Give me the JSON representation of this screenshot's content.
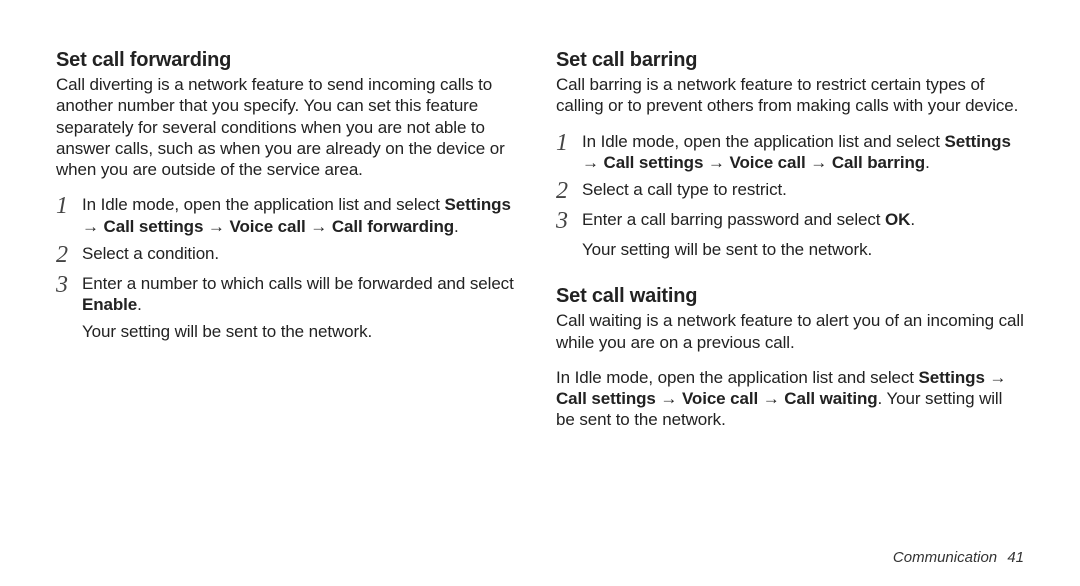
{
  "left": {
    "forwarding": {
      "heading": "Set call forwarding",
      "intro": "Call diverting is a network feature to send incoming calls to another number that you specify. You can set this feature separately for several conditions when you are not able to answer calls, such as when you are already on the device or when you are outside of the service area.",
      "steps": [
        {
          "num": "1",
          "plain_before": "In Idle mode, open the application list and select ",
          "bold1": "Settings",
          "arrow1": " → ",
          "bold2": "Call settings",
          "arrow2": " → ",
          "bold3": "Voice call",
          "arrow3": " → ",
          "bold4": "Call forwarding",
          "tail": "."
        },
        {
          "num": "2",
          "plain": "Select a condition."
        },
        {
          "num": "3",
          "plain_before": "Enter a number to which calls will be forwarded and select ",
          "bold1": "Enable",
          "tail": ".",
          "after": "Your setting will be sent to the network."
        }
      ]
    }
  },
  "right": {
    "barring": {
      "heading": "Set call barring",
      "intro": "Call barring is a network feature to restrict certain types of calling or to prevent others from making calls with your device.",
      "steps": [
        {
          "num": "1",
          "plain_before": "In Idle mode, open the application list and select ",
          "bold1": "Settings",
          "arrow1": " → ",
          "bold2": "Call settings",
          "arrow2": " → ",
          "bold3": "Voice call",
          "arrow3": " → ",
          "bold4": "Call barring",
          "tail": "."
        },
        {
          "num": "2",
          "plain": "Select a call type to restrict."
        },
        {
          "num": "3",
          "plain_before": "Enter a call barring password and select ",
          "bold1": "OK",
          "tail": ".",
          "after": "Your setting will be sent to the network."
        }
      ]
    },
    "waiting": {
      "heading": "Set call waiting",
      "intro": "Call waiting is a network feature to alert you of an incoming call while you are on a previous call.",
      "para2_before": "In Idle mode, open the application list and select ",
      "para2_bold1": "Settings",
      "para2_a1": " → ",
      "para2_bold2": "Call settings",
      "para2_a2": " → ",
      "para2_bold3": "Voice call",
      "para2_a3": " → ",
      "para2_bold4": "Call waiting",
      "para2_tail": ". Your setting will be sent to the network."
    }
  },
  "footer": {
    "chapter": "Communication",
    "page": "41"
  }
}
